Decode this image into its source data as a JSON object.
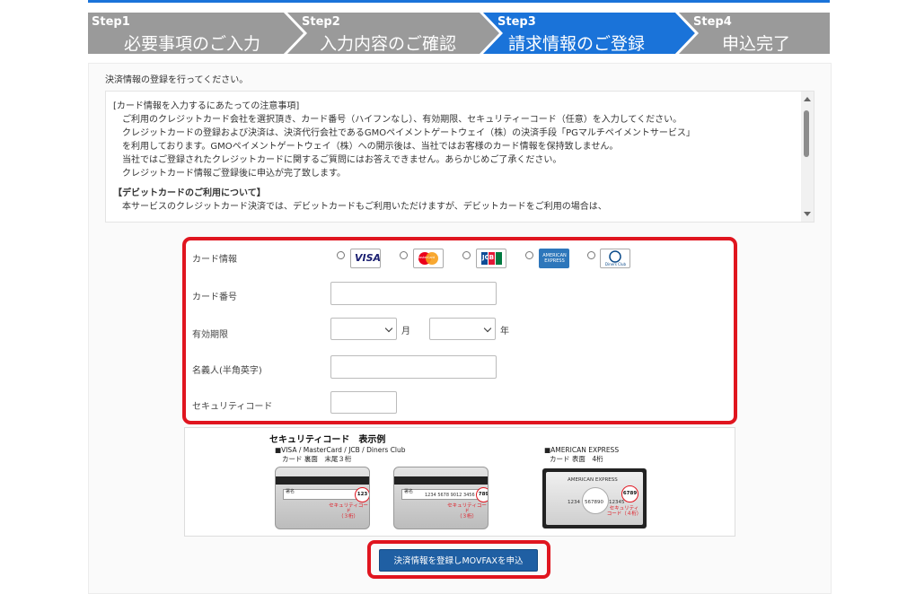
{
  "steps": [
    {
      "num": "Step1",
      "label": "必要事項のご入力",
      "state": "done",
      "color": "#9a9a9a"
    },
    {
      "num": "Step2",
      "label": "入力内容のご確認",
      "state": "done",
      "color": "#9a9a9a"
    },
    {
      "num": "Step3",
      "label": "請求情報のご登録",
      "state": "current",
      "color": "#1a73d9"
    },
    {
      "num": "Step4",
      "label": "申込完了",
      "state": "todo",
      "color": "#9a9a9a"
    }
  ],
  "intro": "決済情報の登録を行ってください。",
  "notice": {
    "heading": "[カード情報を入力するにあたっての注意事項]",
    "lines": [
      "ご利用のクレジットカード会社を選択頂き、カード番号（ハイフンなし）、有効期限、セキュリティーコード（任意）を入力してください。",
      "クレジットカードの登録および決済は、決済代行会社であるGMOペイメントゲートウェイ（株）の決済手段「PGマルチペイメントサービス」",
      "を利用しております。GMOペイメントゲートウェイ（株）への開示後は、当社ではお客様のカード情報を保持致しません。",
      "当社ではご登録されたクレジットカードに関するご質問にはお答えできません。あらかじめご了承ください。",
      "クレジットカード情報ご登録後に申込が完了致します。"
    ],
    "debit_heading": "【デビットカードのご利用について】",
    "debit_line": "本サービスのクレジットカード決済では、デビットカードもご利用いただけますが、デビットカードをご利用の場合は、"
  },
  "form": {
    "card_info_label": "カード情報",
    "card_brands": [
      {
        "name": "VISA",
        "text": "VISA"
      },
      {
        "name": "MasterCard",
        "text": "MasterCard"
      },
      {
        "name": "JCB",
        "text": "JCB"
      },
      {
        "name": "AMERICAN EXPRESS",
        "text": "AMERICAN EXPRESS"
      },
      {
        "name": "Diners Club",
        "text": "Diners Club"
      }
    ],
    "card_number_label": "カード番号",
    "card_number_value": "",
    "expiry_label": "有効期限",
    "month_value": "",
    "month_unit": "月",
    "year_value": "",
    "year_unit": "年",
    "holder_label": "名義人(半角英字)",
    "holder_value": "",
    "security_label": "セキュリティコード",
    "security_value": ""
  },
  "security_example": {
    "title": "セキュリティコード　表示例",
    "note_left_1": "■VISA / MasterCard / JCB / Diners Club",
    "note_left_2": "カード 裏面　末尾３桁",
    "note_right_1": "■AMERICAN EXPRESS",
    "note_right_2": "カード 表面　4桁",
    "card1": {
      "sig_label": "署名",
      "code": "123",
      "red_1": "セキュリティコード",
      "red_2": "（３桁）"
    },
    "card2": {
      "sig_label": "署名",
      "number": "1234 5678 9012 3456",
      "code": "789",
      "red_1": "セキュリティコード",
      "red_2": "（３桁）"
    },
    "card3": {
      "brand": "AMERICAN EXPRESS",
      "code": "6789",
      "num_left": "1234",
      "num_mid": "567890",
      "num_right": "12345",
      "red_1": "セキュリティ",
      "red_2": "コード（４桁）"
    }
  },
  "submit_label": "決済情報を登録しMOVFAXを申込",
  "colors": {
    "accent": "#1a73d9",
    "highlight": "#e0151f",
    "button": "#1f5fa3"
  }
}
